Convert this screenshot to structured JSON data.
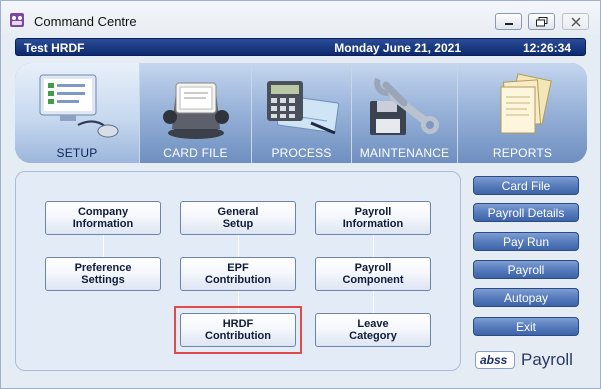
{
  "window": {
    "title": "Command Centre"
  },
  "header": {
    "company": "Test HRDF",
    "date": "Monday June 21, 2021",
    "time": "12:26:34"
  },
  "tabs": [
    {
      "label": "SETUP",
      "icon": "computer-checklist-icon",
      "active": true
    },
    {
      "label": "CARD FILE",
      "icon": "rolodex-icon",
      "active": false
    },
    {
      "label": "PROCESS",
      "icon": "calculator-check-icon",
      "active": false
    },
    {
      "label": "MAINTENANCE",
      "icon": "wrench-disk-icon",
      "active": false
    },
    {
      "label": "REPORTS",
      "icon": "documents-icon",
      "active": false
    }
  ],
  "functions": [
    {
      "line1": "Company",
      "line2": "Information"
    },
    {
      "line1": "General",
      "line2": "Setup"
    },
    {
      "line1": "Payroll",
      "line2": "Information"
    },
    {
      "line1": "Preference",
      "line2": "Settings"
    },
    {
      "line1": "EPF",
      "line2": "Contribution"
    },
    {
      "line1": "Payroll",
      "line2": "Component"
    },
    {
      "line1": "HRDF",
      "line2": "Contribution"
    },
    {
      "line1": "Leave",
      "line2": "Category"
    }
  ],
  "side_buttons": [
    {
      "label": "Card File"
    },
    {
      "label": "Payroll Details"
    },
    {
      "label": "Pay Run"
    },
    {
      "label": "Payroll"
    },
    {
      "label": "Autopay"
    },
    {
      "label": "Exit"
    }
  ],
  "logo": {
    "brand": "abss",
    "product": "Payroll"
  },
  "colors": {
    "header_bg": "#0e2a70",
    "tab_panel": "#7d98c2",
    "side_button": "#4a6fb3",
    "highlight": "#e14a4a"
  }
}
